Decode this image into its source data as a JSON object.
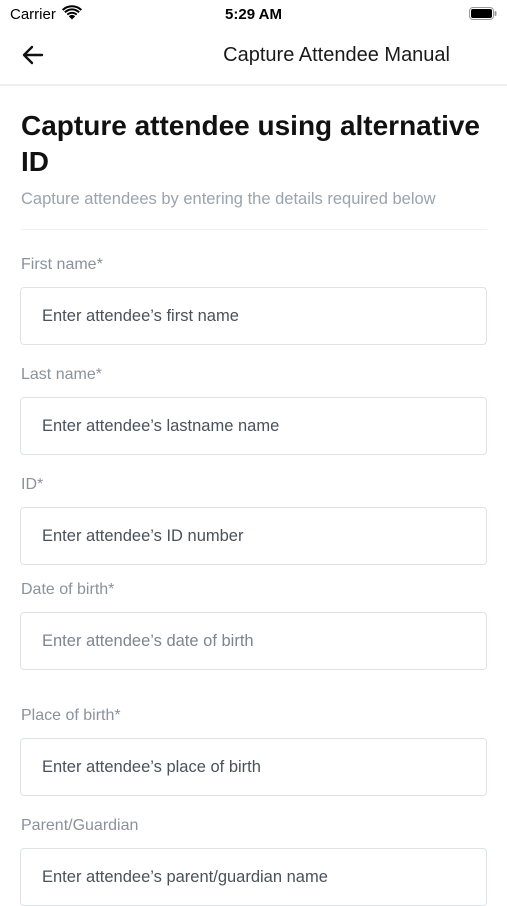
{
  "status_bar": {
    "carrier": "Carrier",
    "time": "5:29 AM",
    "wifi_icon": "wifi-icon",
    "battery_icon": "battery-icon"
  },
  "nav": {
    "back_icon": "arrow-left-icon",
    "title": "Capture Attendee Manual"
  },
  "page": {
    "heading": "Capture attendee using alternative ID",
    "subheading": "Capture attendees by entering the details required below"
  },
  "form": {
    "first_name": {
      "label": "First name*",
      "placeholder": "Enter attendee’s first name",
      "value": ""
    },
    "last_name": {
      "label": "Last name*",
      "placeholder": "Enter attendee’s lastname name",
      "value": ""
    },
    "id_number": {
      "label": "ID*",
      "placeholder": "Enter attendee’s ID number",
      "value": ""
    },
    "date_of_birth": {
      "label": "Date of birth*",
      "placeholder": "Enter attendee’s date of birth",
      "value": ""
    },
    "place_of_birth": {
      "label": "Place of birth*",
      "placeholder": "Enter attendee’s place of birth",
      "value": ""
    },
    "parent_guardian": {
      "label": "Parent/Guardian",
      "placeholder": "Enter attendee’s parent/guardian name",
      "value": ""
    }
  },
  "colors": {
    "label": "#8a929c",
    "subheading": "#9aa3ae",
    "input_border": "#dfe3e8",
    "divider": "#eef0f3"
  }
}
